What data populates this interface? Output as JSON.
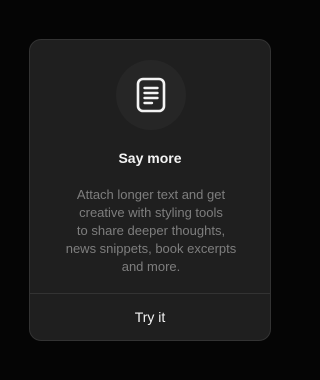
{
  "dialog": {
    "icon": "document-text-icon",
    "title": "Say more",
    "body_lines": [
      "Attach longer text and get",
      "creative with styling tools",
      "to share deeper thoughts,",
      "news snippets, book excerpts",
      "and more."
    ],
    "button_label": "Try it"
  },
  "colors": {
    "backdrop": "#050505",
    "dialog_bg": "#1f1f1f",
    "title": "#f3f3f3",
    "body": "#7e7e7e",
    "divider": "#333333"
  }
}
